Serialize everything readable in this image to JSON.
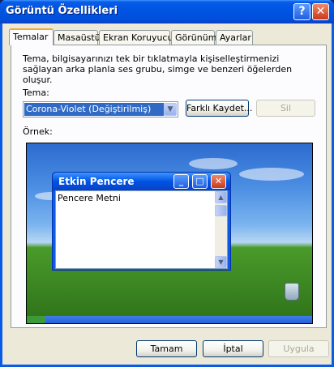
{
  "window": {
    "title": "Görüntü Özellikleri"
  },
  "tabs": [
    {
      "label": "Temalar"
    },
    {
      "label": "Masaüstü"
    },
    {
      "label": "Ekran Koruyucu"
    },
    {
      "label": "Görünüm"
    },
    {
      "label": "Ayarlar"
    }
  ],
  "themes": {
    "description": "Tema, bilgisayarınızı tek bir tıklatmayla kişiselleştirmenizi sağlayan arka planla ses grubu, simge ve benzeri öğelerden oluşur.",
    "theme_label": "Tema:",
    "theme_value": "Corona-Violet (Değiştirilmiş)",
    "save_as_label": "Farklı Kaydet...",
    "delete_label": "Sil",
    "sample_label": "Örnek:"
  },
  "preview": {
    "window_title": "Etkin Pencere",
    "window_text": "Pencere Metni"
  },
  "footer": {
    "ok_label": "Tamam",
    "cancel_label": "İptal",
    "apply_label": "Uygula"
  },
  "colors": {
    "titlebar": "#0054e3",
    "selection": "#316ac5",
    "tab_highlight": "#f1a73c"
  },
  "icons": {
    "help": "question-mark",
    "close": "x"
  }
}
